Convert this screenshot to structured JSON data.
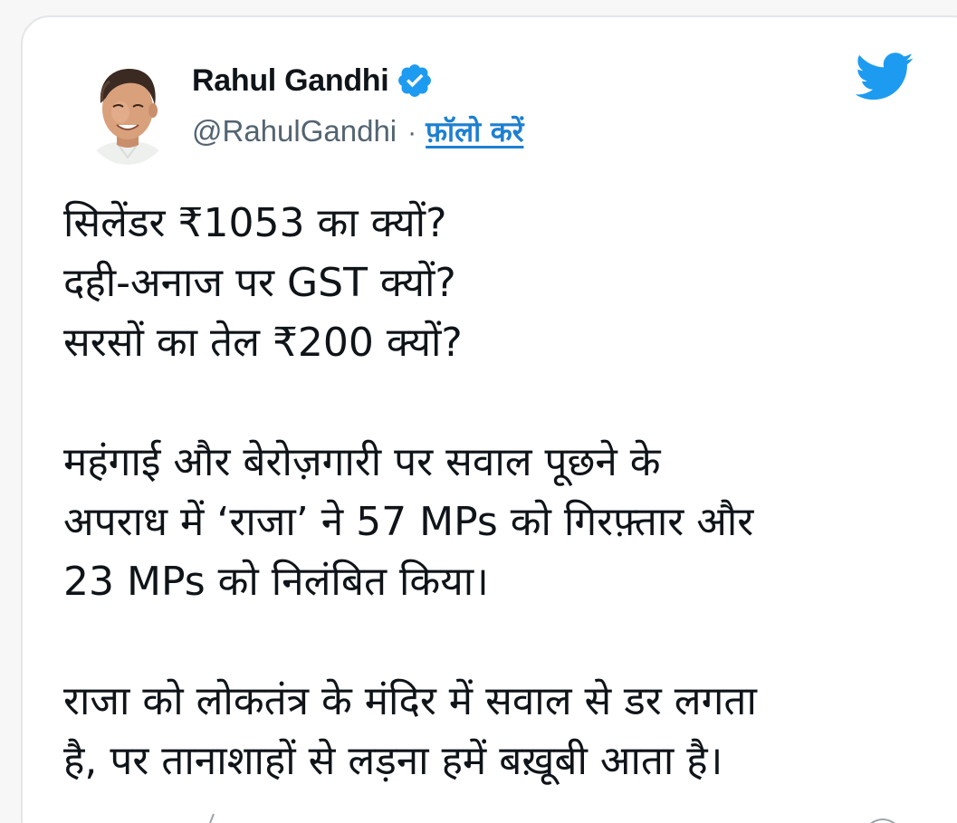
{
  "tweet": {
    "author_name": "Rahul Gandhi",
    "handle": "@RahulGandhi",
    "separator": "·",
    "follow_label": "फ़ॉलो करें",
    "paragraphs": [
      [
        "सिलेंडर ₹1053 का क्यों?",
        "दही-अनाज पर GST क्यों?",
        "सरसों का तेल ₹200 क्यों?"
      ],
      [
        "महंगाई और बेरोज़गारी पर सवाल पूछने के",
        "अपराध में ‘राजा’ ने 57 MPs को गिरफ़्तार और",
        "23 MPs को निलंबित किया।"
      ],
      [
        "राजा को लोकतंत्र के मंदिर में सवाल से डर लगता",
        "है, पर तानाशाहों से लड़ना हमें बख़ूबी आता है।"
      ]
    ]
  },
  "icons": {
    "verified": "verified-badge-icon",
    "brand": "twitter-bird-icon"
  },
  "colors": {
    "brand_blue": "#1d9bf0",
    "link_blue": "#1d7fd1",
    "text_primary": "#0f1419",
    "text_secondary": "#536471"
  }
}
